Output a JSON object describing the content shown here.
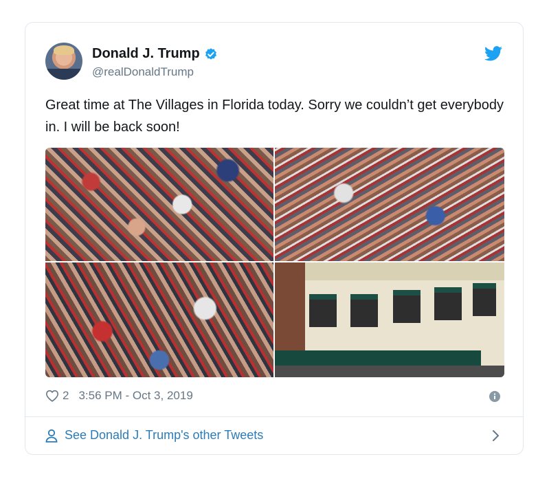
{
  "tweet": {
    "author_name": "Donald J. Trump",
    "author_handle": "@realDonaldTrump",
    "text": "Great time at The Villages in Florida today. Sorry we couldn’t get everybody in. I will be back soon!",
    "likes": "2",
    "timestamp": "3:56 PM - Oct 3, 2019"
  },
  "footer": {
    "link_label": "See Donald J. Trump's other Tweets"
  },
  "icons": {
    "verified": "verified-badge-icon",
    "brand": "twitter-bird-icon",
    "like": "heart-icon",
    "info": "info-icon",
    "profile": "person-icon",
    "next": "chevron-right-icon"
  },
  "colors": {
    "brand_blue": "#1da1f2",
    "link_blue": "#2b7bb9",
    "muted": "#657786",
    "border": "#e1e8ed"
  }
}
